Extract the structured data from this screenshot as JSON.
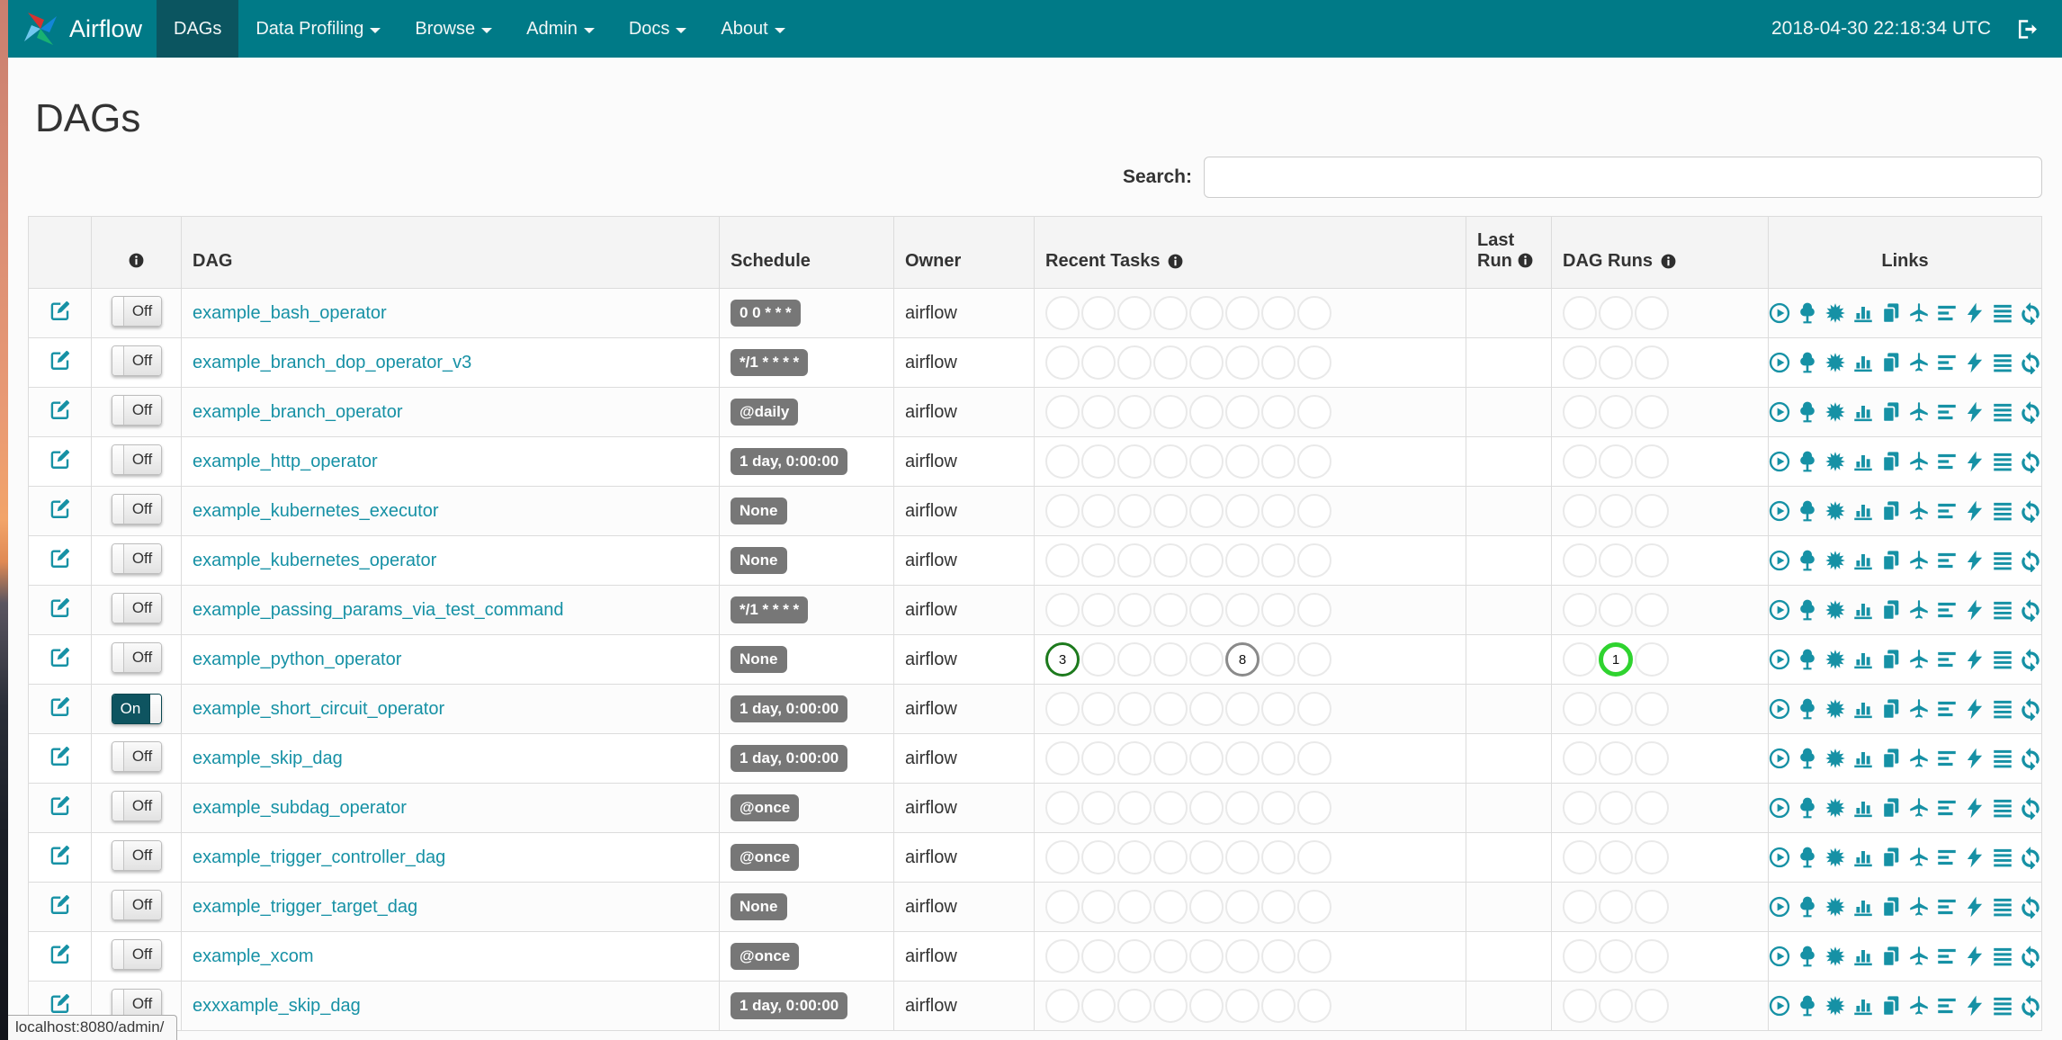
{
  "navbar": {
    "brand": "Airflow",
    "items": [
      {
        "label": "DAGs",
        "active": true,
        "dropdown": false
      },
      {
        "label": "Data Profiling",
        "active": false,
        "dropdown": true
      },
      {
        "label": "Browse",
        "active": false,
        "dropdown": true
      },
      {
        "label": "Admin",
        "active": false,
        "dropdown": true
      },
      {
        "label": "Docs",
        "active": false,
        "dropdown": true
      },
      {
        "label": "About",
        "active": false,
        "dropdown": true
      }
    ],
    "clock": "2018-04-30 22:18:34 UTC"
  },
  "page": {
    "title": "DAGs",
    "search_label": "Search:",
    "search_value": "",
    "status_bar": "localhost:8080/admin/"
  },
  "table": {
    "headers": {
      "edit": "",
      "info": "",
      "dag": "DAG",
      "schedule": "Schedule",
      "owner": "Owner",
      "recent_tasks": "Recent Tasks",
      "last_run": "Last Run",
      "dag_runs": "DAG Runs",
      "links": "Links"
    },
    "recent_task_slots": 8,
    "dag_run_slots": 3,
    "link_icons": [
      {
        "name": "trigger-dag-link",
        "icon": "play-circle-icon"
      },
      {
        "name": "tree-view-link",
        "icon": "tree-icon"
      },
      {
        "name": "graph-view-link",
        "icon": "burst-icon"
      },
      {
        "name": "task-duration-link",
        "icon": "bar-chart-icon"
      },
      {
        "name": "task-tries-link",
        "icon": "copy-pages-icon"
      },
      {
        "name": "landing-times-link",
        "icon": "airplane-icon"
      },
      {
        "name": "gantt-view-link",
        "icon": "align-left-icon"
      },
      {
        "name": "code-view-link",
        "icon": "lightning-bolt-icon"
      },
      {
        "name": "dag-details-link",
        "icon": "menu-lines-icon"
      },
      {
        "name": "refresh-link",
        "icon": "refresh-icon"
      }
    ],
    "rows": [
      {
        "name": "example_bash_operator",
        "toggle": "Off",
        "schedule": "0 0 * * *",
        "owner": "airflow",
        "last_run": "",
        "recent_tasks": [],
        "dag_runs": []
      },
      {
        "name": "example_branch_dop_operator_v3",
        "toggle": "Off",
        "schedule": "*/1 * * * *",
        "owner": "airflow",
        "last_run": "",
        "recent_tasks": [],
        "dag_runs": []
      },
      {
        "name": "example_branch_operator",
        "toggle": "Off",
        "schedule": "@daily",
        "owner": "airflow",
        "last_run": "",
        "recent_tasks": [],
        "dag_runs": []
      },
      {
        "name": "example_http_operator",
        "toggle": "Off",
        "schedule": "1 day, 0:00:00",
        "owner": "airflow",
        "last_run": "",
        "recent_tasks": [],
        "dag_runs": []
      },
      {
        "name": "example_kubernetes_executor",
        "toggle": "Off",
        "schedule": "None",
        "owner": "airflow",
        "last_run": "",
        "recent_tasks": [],
        "dag_runs": []
      },
      {
        "name": "example_kubernetes_operator",
        "toggle": "Off",
        "schedule": "None",
        "owner": "airflow",
        "last_run": "",
        "recent_tasks": [],
        "dag_runs": []
      },
      {
        "name": "example_passing_params_via_test_command",
        "toggle": "Off",
        "schedule": "*/1 * * * *",
        "owner": "airflow",
        "last_run": "",
        "recent_tasks": [],
        "dag_runs": []
      },
      {
        "name": "example_python_operator",
        "toggle": "Off",
        "schedule": "None",
        "owner": "airflow",
        "last_run": "",
        "recent_tasks": [
          {
            "slot": 0,
            "count": "3",
            "state": "success"
          },
          {
            "slot": 5,
            "count": "8",
            "state": "queued"
          }
        ],
        "dag_runs": [
          {
            "slot": 1,
            "count": "1",
            "state": "running"
          }
        ]
      },
      {
        "name": "example_short_circuit_operator",
        "toggle": "On",
        "schedule": "1 day, 0:00:00",
        "owner": "airflow",
        "last_run": "",
        "recent_tasks": [],
        "dag_runs": []
      },
      {
        "name": "example_skip_dag",
        "toggle": "Off",
        "schedule": "1 day, 0:00:00",
        "owner": "airflow",
        "last_run": "",
        "recent_tasks": [],
        "dag_runs": []
      },
      {
        "name": "example_subdag_operator",
        "toggle": "Off",
        "schedule": "@once",
        "owner": "airflow",
        "last_run": "",
        "recent_tasks": [],
        "dag_runs": []
      },
      {
        "name": "example_trigger_controller_dag",
        "toggle": "Off",
        "schedule": "@once",
        "owner": "airflow",
        "last_run": "",
        "recent_tasks": [],
        "dag_runs": []
      },
      {
        "name": "example_trigger_target_dag",
        "toggle": "Off",
        "schedule": "None",
        "owner": "airflow",
        "last_run": "",
        "recent_tasks": [],
        "dag_runs": []
      },
      {
        "name": "example_xcom",
        "toggle": "Off",
        "schedule": "@once",
        "owner": "airflow",
        "last_run": "",
        "recent_tasks": [],
        "dag_runs": []
      },
      {
        "name": "exxxample_skip_dag",
        "toggle": "Off",
        "schedule": "1 day, 0:00:00",
        "owner": "airflow",
        "last_run": "",
        "recent_tasks": [],
        "dag_runs": []
      }
    ]
  },
  "colors": {
    "navbar_bg": "#007a87",
    "navbar_active_bg": "#0b5560",
    "accent_link": "#1691a5",
    "schedule_badge_bg": "#777777",
    "task_success": "#1d7a1d",
    "task_queued": "#8a8a8a",
    "dagrun_running": "#2fd32f"
  }
}
